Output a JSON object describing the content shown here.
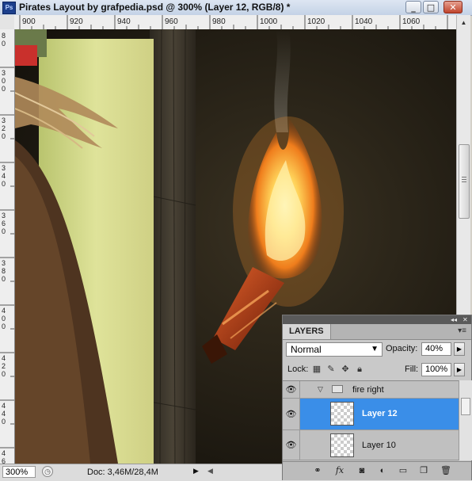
{
  "window": {
    "app_icon_label": "Ps",
    "title": "Pirates Layout by grafpedia.psd @ 300% (Layer 12, RGB/8) *",
    "minimize_label": "_",
    "maximize_label": "□",
    "close_label": "✕"
  },
  "ruler": {
    "top_ticks": [
      "900",
      "920",
      "940",
      "960",
      "980",
      "1000",
      "1020",
      "1040",
      "1060"
    ],
    "left_ticks": [
      "80",
      "300",
      "320",
      "340",
      "360",
      "380",
      "400",
      "420",
      "440",
      "46"
    ]
  },
  "status": {
    "zoom": "300%",
    "doc_info": "Doc: 3,46M/28,4M",
    "arrow": "▶",
    "scroll_left": "◀"
  },
  "layers_panel": {
    "collapse_label": "◂◂",
    "close_label": "✕",
    "tab_label": "LAYERS",
    "menu_label": "▾≡",
    "blend_mode": "Normal",
    "opacity_label": "Opacity:",
    "opacity_value": "40%",
    "lock_label": "Lock:",
    "fill_label": "Fill:",
    "fill_value": "100%",
    "group": {
      "name": "fire right",
      "expanded": true
    },
    "layers": [
      {
        "name": "Layer 12",
        "selected": true,
        "visible": true
      },
      {
        "name": "Layer 10",
        "selected": false,
        "visible": true
      }
    ],
    "eye_glyph": "👁"
  },
  "colors": {
    "selection": "#3a8ee8",
    "canvas_bg": "#1b1811"
  }
}
